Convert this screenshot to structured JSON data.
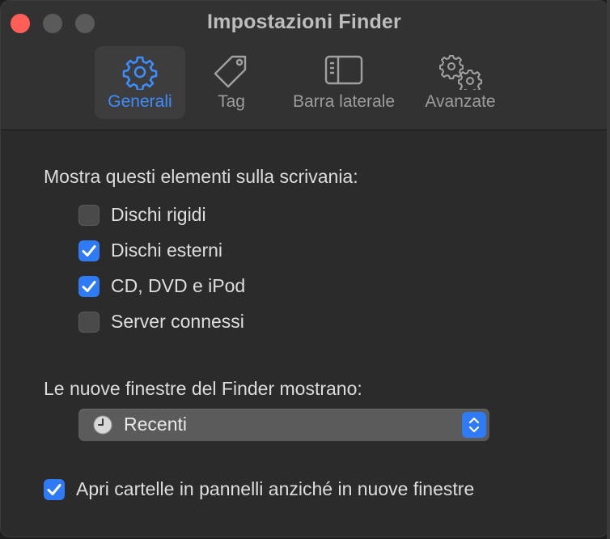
{
  "window": {
    "title": "Impostazioni Finder"
  },
  "tabs": [
    {
      "label": "Generali",
      "icon": "gear-icon",
      "active": true
    },
    {
      "label": "Tag",
      "icon": "tag-icon",
      "active": false
    },
    {
      "label": "Barra laterale",
      "icon": "sidebar-icon",
      "active": false
    },
    {
      "label": "Avanzate",
      "icon": "gears-icon",
      "active": false
    }
  ],
  "desktop_section": {
    "heading": "Mostra questi elementi sulla scrivania:",
    "items": [
      {
        "label": "Dischi rigidi",
        "checked": false
      },
      {
        "label": "Dischi esterni",
        "checked": true
      },
      {
        "label": "CD, DVD e iPod",
        "checked": true
      },
      {
        "label": "Server connessi",
        "checked": false
      }
    ]
  },
  "new_windows": {
    "heading": "Le nuove finestre del Finder mostrano:",
    "selected": "Recenti",
    "icon": "clock-icon"
  },
  "open_folders": {
    "label": "Apri cartelle in pannelli anziché in nuove finestre",
    "checked": true
  },
  "colors": {
    "accent": "#2f7bf6",
    "active_tab_text": "#3d8dfd",
    "close_button": "#ff5f57"
  }
}
